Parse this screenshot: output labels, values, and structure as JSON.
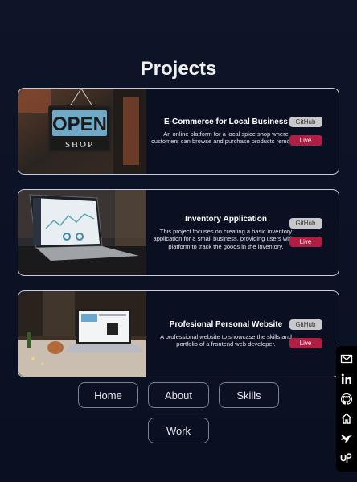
{
  "page": {
    "title": "Projects"
  },
  "projects": [
    {
      "title": "E-Commerce for Local Business",
      "description": "An online platform for a local spice shop where customers can browse and purchase products remotely.",
      "github_label": "GitHub",
      "live_label": "Live",
      "image": "open-shop-sign-image",
      "sign_line1": "OPEN",
      "sign_line2": "SHOP"
    },
    {
      "title": "Inventory Application",
      "description": "This project focuses on creating a basic inventory application for a small business, providing users with a platform to track the goods in the inventory.",
      "github_label": "GitHub",
      "live_label": "Live",
      "image": "laptop-dashboard-image"
    },
    {
      "title": "Profesional Personal Website",
      "description": "A professional website to showcase the skills and portfolio of a frontend web developer.",
      "github_label": "GitHub",
      "live_label": "Live",
      "image": "desk-laptop-image"
    }
  ],
  "nav": {
    "home": "Home",
    "about": "About",
    "skills": "Skills",
    "work": "Work"
  },
  "social": [
    "mail-icon",
    "linkedin-icon",
    "github-icon",
    "home-icon",
    "hummingbird-icon",
    "upwork-icon"
  ],
  "colors": {
    "background": "#0e1528",
    "live_button": "#b01e43",
    "github_button": "#c9c9cb",
    "card_border": "#c9ccd6"
  }
}
